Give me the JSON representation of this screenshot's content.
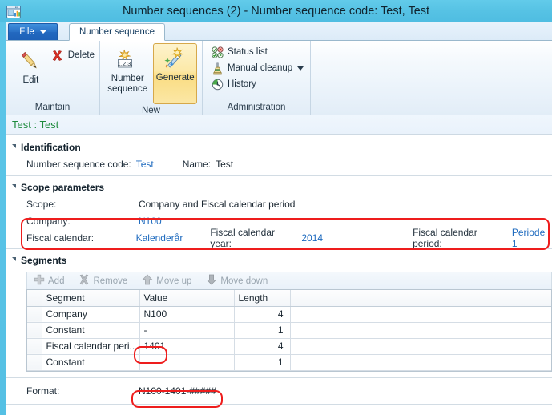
{
  "window": {
    "title": "Number sequences (2) - Number sequence code: Test, Test",
    "icon": "application-window-chart-icon"
  },
  "tabs": {
    "file_label": "File",
    "active_tab": "Number sequence"
  },
  "ribbon": {
    "groups": [
      {
        "name": "Maintain",
        "label": "Maintain",
        "big_buttons": [
          {
            "label": "Edit",
            "icon": "pencil-edit-icon",
            "selected": false
          }
        ],
        "small_items": [
          {
            "label": "Delete",
            "icon": "red-x-delete-icon",
            "has_dropdown": false
          }
        ]
      },
      {
        "name": "New",
        "label": "New",
        "big_buttons": [
          {
            "label": "Number sequence",
            "icon": "number-123-icon",
            "selected": false
          },
          {
            "label": "Generate",
            "icon": "magic-wand-icon",
            "selected": true
          }
        ],
        "small_items": []
      },
      {
        "name": "Administration",
        "label": "Administration",
        "big_buttons": [],
        "small_items": [
          {
            "label": "Status list",
            "icon": "status-list-icon",
            "has_dropdown": false
          },
          {
            "label": "Manual cleanup",
            "icon": "broom-cleanup-icon",
            "has_dropdown": true
          },
          {
            "label": "History",
            "icon": "clock-history-icon",
            "has_dropdown": false
          }
        ]
      }
    ]
  },
  "content": {
    "caption": "Test : Test",
    "identification": {
      "header": "Identification",
      "code_label": "Number sequence code:",
      "code_value": "Test",
      "name_label": "Name:",
      "name_value": "Test"
    },
    "scope_parameters": {
      "header": "Scope parameters",
      "scope_label": "Scope:",
      "scope_value": "Company and Fiscal calendar period",
      "company_label": "Company:",
      "company_value": "N100",
      "fiscal_calendar_label": "Fiscal calendar:",
      "fiscal_calendar_value": "Kalenderår",
      "fiscal_year_label": "Fiscal calendar year:",
      "fiscal_year_value": "2014",
      "fiscal_period_label": "Fiscal calendar period:",
      "fiscal_period_value": "Periode 1"
    },
    "segments": {
      "header": "Segments",
      "toolbar": [
        {
          "label": "Add",
          "icon": "plus-add-icon"
        },
        {
          "label": "Remove",
          "icon": "x-remove-icon"
        },
        {
          "label": "Move up",
          "icon": "arrow-up-icon"
        },
        {
          "label": "Move down",
          "icon": "arrow-down-icon"
        }
      ],
      "columns": [
        "Segment",
        "Value",
        "Length"
      ],
      "rows": [
        {
          "segment": "Company",
          "value": "N100",
          "length": "4"
        },
        {
          "segment": "Constant",
          "value": "-",
          "length": "1"
        },
        {
          "segment": "Fiscal calendar peri...",
          "value": "1401",
          "length": "4"
        },
        {
          "segment": "Constant",
          "value": "-",
          "length": "1"
        }
      ]
    },
    "format": {
      "label": "Format:",
      "value": "N100-1401-#####"
    }
  },
  "colors": {
    "titlebar": "#56c2e4",
    "accent_strip": "#5fc8e8",
    "file_tab": "#2268bf",
    "caption_text": "#1d8a3c",
    "link": "#1f6bbf",
    "highlight": "#ee1d1d",
    "selected_button": "#fadd84"
  }
}
